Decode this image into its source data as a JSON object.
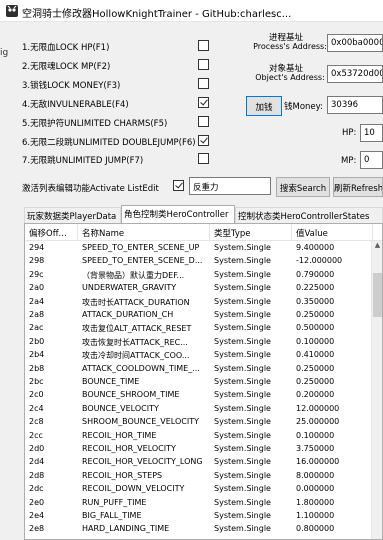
{
  "window": {
    "title": "空洞骑士修改器HollowKnightTrainer - GitHub:charlesc..."
  },
  "left_edge_text": "ig",
  "toggles": [
    {
      "label": "1.无限血LOCK HP(F1)",
      "checked": false
    },
    {
      "label": "2.无限魂LOCK MP(F2)",
      "checked": false
    },
    {
      "label": "3.锁钱LOCK MONEY(F3)",
      "checked": false
    },
    {
      "label": "4.无敌INVULNERABLE(F4)",
      "checked": true
    },
    {
      "label": "5.无限护符UNLIMITED CHARMS(F5)",
      "checked": false
    },
    {
      "label": "6.无限二段跳UNLIMITED DOUBLEJUMP(F6)",
      "checked": true
    },
    {
      "label": "7.无限跳UNLIMITED JUMP(F7)",
      "checked": false
    }
  ],
  "process": {
    "label_cn": "进程基址",
    "label_en": "Process's Address:",
    "value": "0x00ba0000"
  },
  "object": {
    "label_cn": "对象基址",
    "label_en": "Object's Address:",
    "value": "0x53720d00"
  },
  "money": {
    "add_label": "加钱",
    "label": "钱Money:",
    "value": "30396"
  },
  "hp": {
    "label": "HP:",
    "value": "10"
  },
  "mp": {
    "label": "MP:",
    "value": "0"
  },
  "activate_list": {
    "label": "激活列表编辑功能Activate ListEdit",
    "checked": true
  },
  "search": {
    "value": "反重力",
    "button": "搜索Search",
    "refresh": "刷新Refresh"
  },
  "tabs": [
    {
      "label": "玩家数据类PlayerData",
      "active": false
    },
    {
      "label": "角色控制类HeroController",
      "active": true
    },
    {
      "label": "控制状态类HeroControllerStates",
      "active": false
    }
  ],
  "columns": [
    "偏移Off...",
    "名称Name",
    "类型Type",
    "值Value"
  ],
  "rows": [
    [
      "294",
      "SPEED_TO_ENTER_SCENE_UP",
      "System.Single",
      "9.400000"
    ],
    [
      "298",
      "SPEED_TO_ENTER_SCENE_D...",
      "System.Single",
      "-12.000000"
    ],
    [
      "29c",
      "（背景物品）默认重力DEF...",
      "System.Single",
      "0.790000"
    ],
    [
      "2a0",
      "UNDERWATER_GRAVITY",
      "System.Single",
      "0.225000"
    ],
    [
      "2a4",
      "攻击时长ATTACK_DURATION",
      "System.Single",
      "0.350000"
    ],
    [
      "2a8",
      "ATTACK_DURATION_CH",
      "System.Single",
      "0.250000"
    ],
    [
      "2ac",
      "攻击复位ALT_ATTACK_RESET",
      "System.Single",
      "0.500000"
    ],
    [
      "2b0",
      "攻击恢复时长ATTACK_REC...",
      "System.Single",
      "0.100000"
    ],
    [
      "2b4",
      "攻击冷却时间ATTACK_COO...",
      "System.Single",
      "0.410000"
    ],
    [
      "2b8",
      "ATTACK_COOLDOWN_TIME_...",
      "System.Single",
      "0.250000"
    ],
    [
      "2bc",
      "BOUNCE_TIME",
      "System.Single",
      "0.250000"
    ],
    [
      "2c0",
      "BOUNCE_SHROOM_TIME",
      "System.Single",
      "0.200000"
    ],
    [
      "2c4",
      "BOUNCE_VELOCITY",
      "System.Single",
      "12.000000"
    ],
    [
      "2c8",
      "SHROOM_BOUNCE_VELOCITY",
      "System.Single",
      "25.000000"
    ],
    [
      "2cc",
      "RECOIL_HOR_TIME",
      "System.Single",
      "0.100000"
    ],
    [
      "2d0",
      "RECOIL_HOR_VELOCITY",
      "System.Single",
      "3.750000"
    ],
    [
      "2d4",
      "RECOIL_HOR_VELOCITY_LONG",
      "System.Single",
      "16.000000"
    ],
    [
      "2d8",
      "RECOIL_HOR_STEPS",
      "System.Single",
      "8.000000"
    ],
    [
      "2dc",
      "RECOIL_DOWN_VELOCITY",
      "System.Single",
      "0.000000"
    ],
    [
      "2e0",
      "RUN_PUFF_TIME",
      "System.Single",
      "1.800000"
    ],
    [
      "2e4",
      "BIG_FALL_TIME",
      "System.Single",
      "1.100000"
    ],
    [
      "2e8",
      "HARD_LANDING_TIME",
      "System.Single",
      "0.800000"
    ]
  ]
}
